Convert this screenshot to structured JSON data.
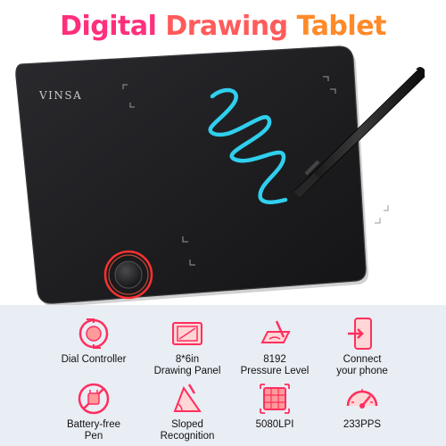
{
  "header": {
    "title_parts": [
      "Digital",
      "Drawing",
      "Tablet"
    ]
  },
  "product": {
    "brand": "VINSA",
    "tablet_color": "#1f1f22",
    "stroke_color": "#2fd0ee",
    "dial_accent": "#ff2f2f"
  },
  "features": [
    {
      "icon": "dial-controller-icon",
      "line1": "Dial Controller",
      "line2": ""
    },
    {
      "icon": "drawing-panel-icon",
      "line1": "8*6in",
      "line2": "Drawing Panel"
    },
    {
      "icon": "pressure-level-icon",
      "line1": "8192",
      "line2": "Pressure Level"
    },
    {
      "icon": "connect-phone-icon",
      "line1": "Connect",
      "line2": "your phone"
    },
    {
      "icon": "battery-free-pen-icon",
      "line1": "Battery-free",
      "line2": "Pen"
    },
    {
      "icon": "sloped-recognition-icon",
      "line1": "Sloped",
      "line2": "Recognition"
    },
    {
      "icon": "lpi-grid-icon",
      "line1": "5080LPI",
      "line2": ""
    },
    {
      "icon": "speed-gauge-icon",
      "line1": "233PPS",
      "line2": ""
    }
  ],
  "accent_colors": {
    "pink": "#ff2f7d",
    "coral": "#ff5b5b",
    "orange": "#ff8a2a"
  }
}
